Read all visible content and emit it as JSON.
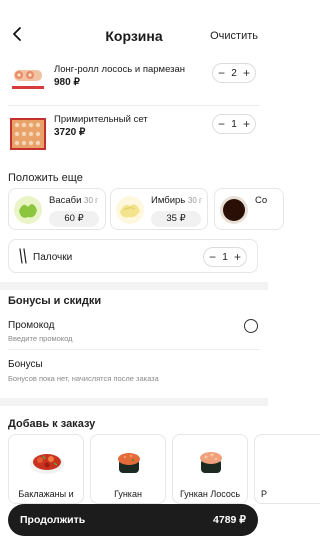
{
  "header": {
    "title": "Корзина",
    "clear_label": "Очистить",
    "back_icon": "arrow-left-icon"
  },
  "cart": {
    "items": [
      {
        "name": "Лонг-ролл лосось и пармезан",
        "price": "980 ₽",
        "quantity": "2"
      },
      {
        "name": "Примирительный сет",
        "price": "3720 ₽",
        "quantity": "1"
      }
    ]
  },
  "addons": {
    "title": "Положить еще",
    "items": [
      {
        "name": "Васаби",
        "weight": "30 г",
        "price": "60 ₽"
      },
      {
        "name": "Имбирь",
        "weight": "30 г",
        "price": "35 ₽"
      },
      {
        "name": "Со",
        "weight": "",
        "price": ""
      }
    ],
    "sticks": {
      "label": "Палочки",
      "quantity": "1"
    }
  },
  "bonuses": {
    "title": "Бонусы и скидки",
    "promo_title": "Промокод",
    "promo_sub": "Введите промокод",
    "bonus_title": "Бонусы",
    "bonus_sub": "Бонусов пока нет, начислятся после заказа"
  },
  "recommendations": {
    "title": "Добавь к заказу",
    "items": [
      {
        "name": "Баклажаны и"
      },
      {
        "name": "Гункан"
      },
      {
        "name": "Гункан Лосось"
      },
      {
        "name": "Р"
      }
    ]
  },
  "checkout": {
    "label": "Продолжить",
    "total": "4789 ₽"
  },
  "colors": {
    "accent_dark": "#1c1c1c",
    "band_gray": "#f3f3f3",
    "border": "#e6e6e6"
  }
}
